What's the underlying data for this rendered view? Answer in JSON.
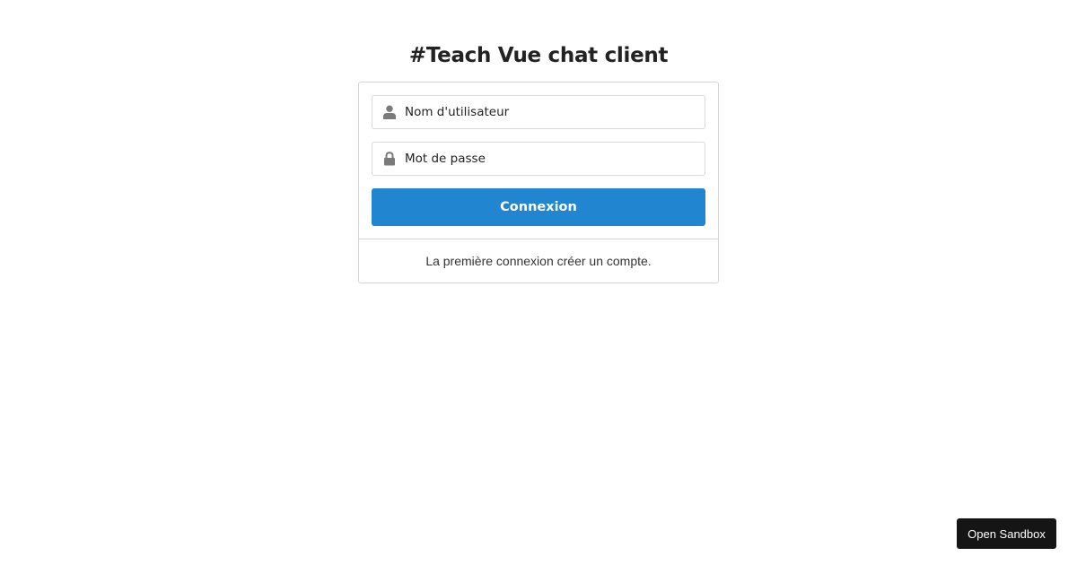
{
  "page": {
    "title": "#Teach Vue chat client"
  },
  "login_form": {
    "username": {
      "icon": "user-icon",
      "placeholder": "Nom d'utilisateur",
      "value": ""
    },
    "password": {
      "icon": "lock-icon",
      "placeholder": "Mot de passe",
      "value": ""
    },
    "submit_label": "Connexion",
    "footer_note": "La première connexion créer un compte."
  },
  "sandbox": {
    "button_label": "Open Sandbox"
  },
  "colors": {
    "primary_button": "#2185d0",
    "sandbox_button": "#151515",
    "border": "#d4d4d5",
    "icon": "#7a7a7a"
  }
}
